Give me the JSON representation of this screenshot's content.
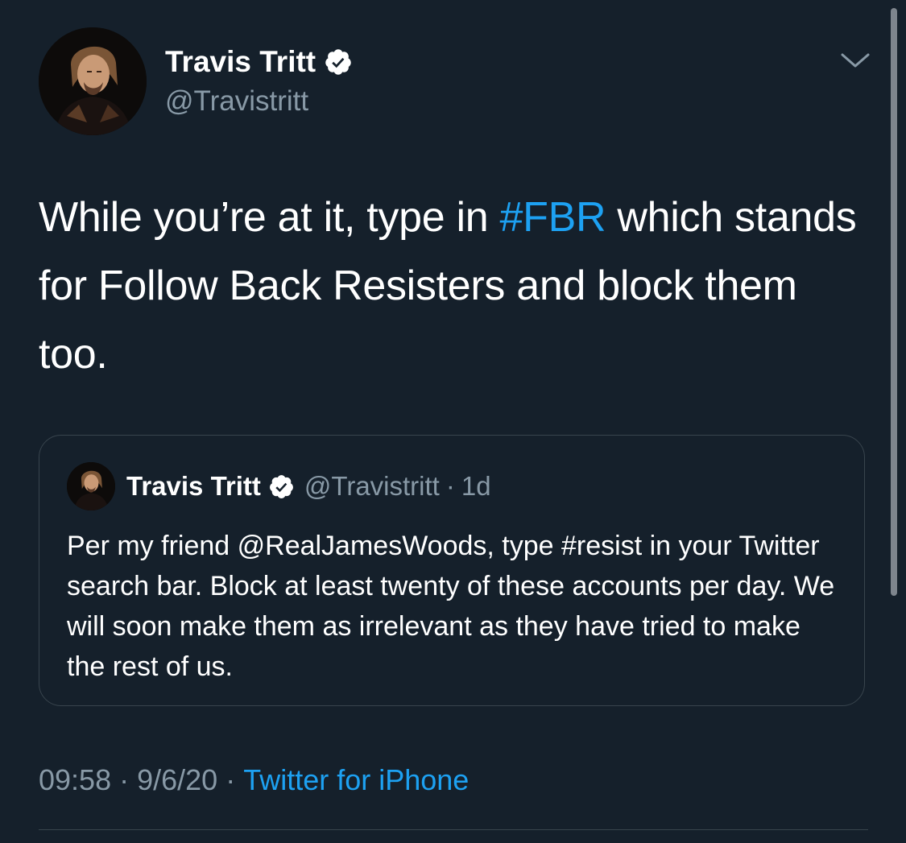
{
  "tweet": {
    "author_name": "Travis Tritt",
    "author_handle": "@Travistritt",
    "text_before": "While you’re at it, type in ",
    "hashtag": "#FBR",
    "text_after": " which stands for Follow Back Resisters and block them too.",
    "time": "09:58",
    "separator": "·",
    "date": "9/6/20",
    "source": "Twitter for iPhone"
  },
  "quoted_tweet": {
    "author_name": "Travis Tritt",
    "author_handle": "@Travistritt",
    "separator": "·",
    "age": "1d",
    "text": "Per my friend @RealJamesWoods, type #resist in your Twitter search bar. Block at least twenty of these accounts per day. We will soon make them as irrelevant as they have tried to make the rest of us."
  },
  "icons": {
    "verified": "verified-badge-icon",
    "menu": "chevron-down-icon"
  },
  "colors": {
    "background": "#15202b",
    "text": "#ffffff",
    "secondary_text": "#8899a6",
    "link": "#1da1f2",
    "border": "#38444d"
  }
}
